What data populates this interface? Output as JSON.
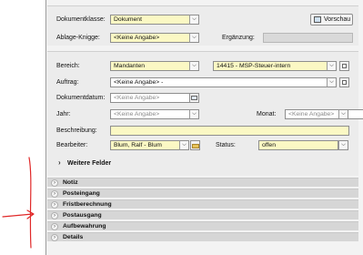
{
  "colors": {
    "field_yellow": "#fbf8c4",
    "panel": "#ececec",
    "section_bar": "#d6d6d6",
    "annotation_red": "#e02828"
  },
  "header": {
    "dokumentklasse_label": "Dokumentklasse:",
    "dokumentklasse_value": "Dokument",
    "vorschau_label": "Vorschau",
    "ablage_label": "Ablage-Knigge:",
    "ablage_value": "<Keine Angabe>",
    "ergaenzung_label": "Ergänzung:",
    "ergaenzung_value": ""
  },
  "form": {
    "bereich_label": "Bereich:",
    "bereich_value": "Mandanten",
    "mandant_value": "14415 - MSP-Steuer-intern",
    "auftrag_label": "Auftrag:",
    "auftrag_value": "<Keine Angabe> -",
    "dokumentdatum_label": "Dokumentdatum:",
    "dokumentdatum_placeholder": "<Keine Angabe>",
    "jahr_label": "Jahr:",
    "jahr_placeholder": "<Keine Angabe>",
    "monat_label": "Monat:",
    "monat_placeholder": "<Keine Angabe>",
    "beschreibung_label": "Beschreibung:",
    "beschreibung_value": "",
    "bearbeiter_label": "Bearbeiter:",
    "bearbeiter_value": "Blum, Ralf - Blum",
    "status_label": "Status:",
    "status_value": "offen",
    "weitere_felder_label": "Weitere Felder"
  },
  "sections": [
    {
      "label": "Notiz"
    },
    {
      "label": "Posteingang"
    },
    {
      "label": "Fristberechnung"
    },
    {
      "label": "Postausgang"
    },
    {
      "label": "Aufbewahrung"
    },
    {
      "label": "Details"
    }
  ],
  "icons": {
    "dropdown": "chevron-down-icon",
    "calendar": "calendar-icon",
    "folder": "folder-icon",
    "expander": "chevron-right-icon",
    "preview": "preview-icon"
  }
}
